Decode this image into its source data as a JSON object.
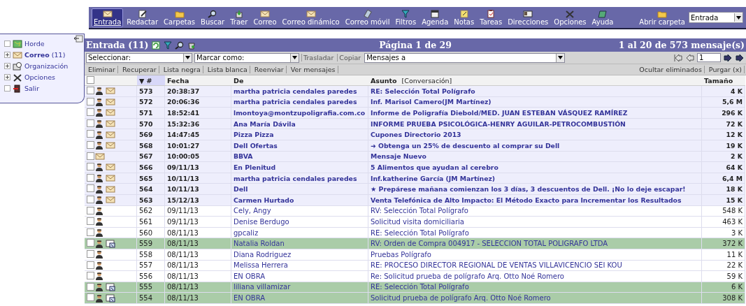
{
  "toolbar": {
    "items": [
      {
        "label": "Entrada",
        "selected": true
      },
      {
        "label": "Redactar",
        "selected": false
      },
      {
        "label": "Carpetas",
        "selected": false
      },
      {
        "label": "Buscar",
        "selected": false
      },
      {
        "label": "Traer",
        "selected": false
      },
      {
        "label": "Correo",
        "selected": false
      },
      {
        "label": "Correo dinámico",
        "selected": false
      },
      {
        "label": "Correo móvil",
        "selected": false
      },
      {
        "label": "Filtros",
        "selected": false
      },
      {
        "label": "Agenda",
        "selected": false
      },
      {
        "label": "Notas",
        "selected": false
      },
      {
        "label": "Tareas",
        "selected": false
      },
      {
        "label": "Direcciones",
        "selected": false
      },
      {
        "label": "Opciones",
        "selected": false
      },
      {
        "label": "Ayuda",
        "selected": false
      }
    ],
    "open_folder": {
      "label": "Abrir carpeta",
      "value": "Entrada"
    }
  },
  "sidebar": {
    "items": [
      {
        "label": "Horde",
        "expandable": false
      },
      {
        "label": "**Correo** (11)",
        "expandable": true
      },
      {
        "label": "Organización",
        "expandable": true
      },
      {
        "label": "Opciones",
        "expandable": true
      },
      {
        "label": "Salir",
        "expandable": false
      }
    ]
  },
  "mailbox": {
    "title": "Entrada (11)",
    "page": "Página 1 de 29",
    "range": "1 al 20 de 573 mensaje(s)",
    "select": "Seleccionar:",
    "mark_as": "Marcar como:",
    "move": "Trasladar",
    "copy": "Copiar",
    "target": "Mensajes a",
    "page_input": "1",
    "actions": [
      "Eliminar",
      "Recuperar",
      "Lista negra",
      "Lista blanca",
      "Reenviar",
      "Ver mensajes"
    ],
    "right_actions": [
      "Ocultar eliminados",
      "Purgar (x)"
    ],
    "all_checked": false,
    "columns": {
      "number": "▼ #",
      "date": "Fecha",
      "from": "De",
      "subject": "Asunto",
      "thread": "[Conversación]",
      "size": "Tamaño"
    },
    "rows": [
      {
        "number": "573",
        "date": "20:38:37",
        "from": "martha patricia cendales paredes",
        "subject": "RE: Selección Total Polígrafo",
        "size": "4 K",
        "unread": true,
        "known": true,
        "forwarded": false,
        "checked": false
      },
      {
        "number": "572",
        "date": "20:06:36",
        "from": "martha patricia cendales paredes",
        "subject": "Inf. Marisol Camero(JM Martínez)",
        "size": "5,6 M",
        "unread": true,
        "known": true,
        "forwarded": false,
        "checked": false
      },
      {
        "number": "571",
        "date": "18:52:41",
        "from": "lmontoya@montzupoligrafia.com.co",
        "subject": "Informe de Poligrafía Diebold/MED. JUAN ESTEBAN VÁSQUEZ RAMÍREZ",
        "size": "296 K",
        "unread": true,
        "known": true,
        "forwarded": false,
        "checked": false
      },
      {
        "number": "570",
        "date": "15:32:36",
        "from": "Ana María Dávila",
        "subject": "INFORME PRUEBA PSICOLÓGICA-HENRY AGUILAR-PETROCOMBUSTIÓN",
        "size": "72 K",
        "unread": true,
        "known": true,
        "forwarded": false,
        "checked": false
      },
      {
        "number": "569",
        "date": "14:47:45",
        "from": "Pizza Pizza",
        "subject": "Cupones Directorio 2013",
        "size": "12 K",
        "unread": true,
        "known": true,
        "forwarded": false,
        "checked": false
      },
      {
        "number": "568",
        "date": "10:01:27",
        "from": "Dell Ofertas",
        "subject": "➜ Obtenga un 25% de descuento al comprar su Dell",
        "size": "19 K",
        "unread": true,
        "known": true,
        "forwarded": false,
        "checked": false
      },
      {
        "number": "567",
        "date": "10:00:05",
        "from": "BBVA",
        "subject": "Mensaje Nuevo",
        "size": "2 K",
        "unread": true,
        "known": false,
        "forwarded": false,
        "checked": false
      },
      {
        "number": "566",
        "date": "09/11/13",
        "from": "En Plenitud",
        "subject": "5 Alimentos que ayudan al cerebro",
        "size": "64 K",
        "unread": true,
        "known": true,
        "forwarded": false,
        "checked": false
      },
      {
        "number": "565",
        "date": "10/11/13",
        "from": "martha patricia cendales paredes",
        "subject": "Inf.katherine García (JM Martínez)",
        "size": "6,4 M",
        "unread": true,
        "known": true,
        "forwarded": false,
        "checked": false
      },
      {
        "number": "564",
        "date": "10/11/13",
        "from": "Dell",
        "subject": "★ Prepárese mañana comienzan los 3 días, 3 descuentos de Dell. ¡No lo deje escapar!",
        "size": "18 K",
        "unread": true,
        "known": true,
        "forwarded": false,
        "checked": false
      },
      {
        "number": "563",
        "date": "15/12/13",
        "from": "Carmen Hurtado",
        "subject": "Venta Telefónica de Alto Impacto: El Método Exacto para Incrementar los Resultados",
        "size": "15 K",
        "unread": true,
        "known": true,
        "forwarded": false,
        "checked": false
      },
      {
        "number": "562",
        "date": "09/11/13",
        "from": "Cely, Angy",
        "subject": "RV: Selección Total Polígrafo",
        "size": "548 K",
        "unread": false,
        "known": true,
        "forwarded": false,
        "checked": false
      },
      {
        "number": "561",
        "date": "09/11/13",
        "from": "Denise Berdugo",
        "subject": "Solicitud visita domiciliaria",
        "size": "463 K",
        "unread": false,
        "known": true,
        "forwarded": false,
        "checked": false
      },
      {
        "number": "560",
        "date": "08/11/13",
        "from": "gpcaliz",
        "subject": "RE: Selección Total Polígrafo",
        "size": "3 K",
        "unread": false,
        "known": true,
        "forwarded": false,
        "checked": false
      },
      {
        "number": "559",
        "date": "08/11/13",
        "from": "Natalia Roldan",
        "subject": "RV: Orden de Compra 004917 - SELECCION TOTAL POLIGRAFO LTDA",
        "size": "372 K",
        "unread": false,
        "known": true,
        "forwarded": true,
        "checked": false
      },
      {
        "number": "558",
        "date": "08/11/13",
        "from": "Diana Rodriguez",
        "subject": "Pruebas Polígrafo",
        "size": "11 K",
        "unread": false,
        "known": true,
        "forwarded": false,
        "checked": false
      },
      {
        "number": "557",
        "date": "08/11/13",
        "from": "Melissa Herrera",
        "subject": "RE: PROCESO DIRECTOR REGIONAL DE VENTAS VILLAVICENCIO SEI KOU",
        "size": "22 K",
        "unread": false,
        "known": true,
        "forwarded": false,
        "checked": false
      },
      {
        "number": "556",
        "date": "08/11/13",
        "from": "EN OBRA",
        "subject": "Re: Solicitud prueba de polígrafo Arq. Otto Noé Romero",
        "size": "59 K",
        "unread": false,
        "known": true,
        "forwarded": false,
        "checked": false
      },
      {
        "number": "555",
        "date": "08/11/13",
        "from": "liliana villamizar",
        "subject": "RE: Selección Total Polígrafo",
        "size": "6 K",
        "unread": false,
        "known": true,
        "forwarded": true,
        "checked": false
      },
      {
        "number": "554",
        "date": "08/11/13",
        "from": "EN OBRA",
        "subject": "Solicitud prueba de polígrafo Arq. Otto Noé Romero",
        "size": "308 K",
        "unread": false,
        "known": true,
        "forwarded": true,
        "checked": false
      }
    ]
  }
}
